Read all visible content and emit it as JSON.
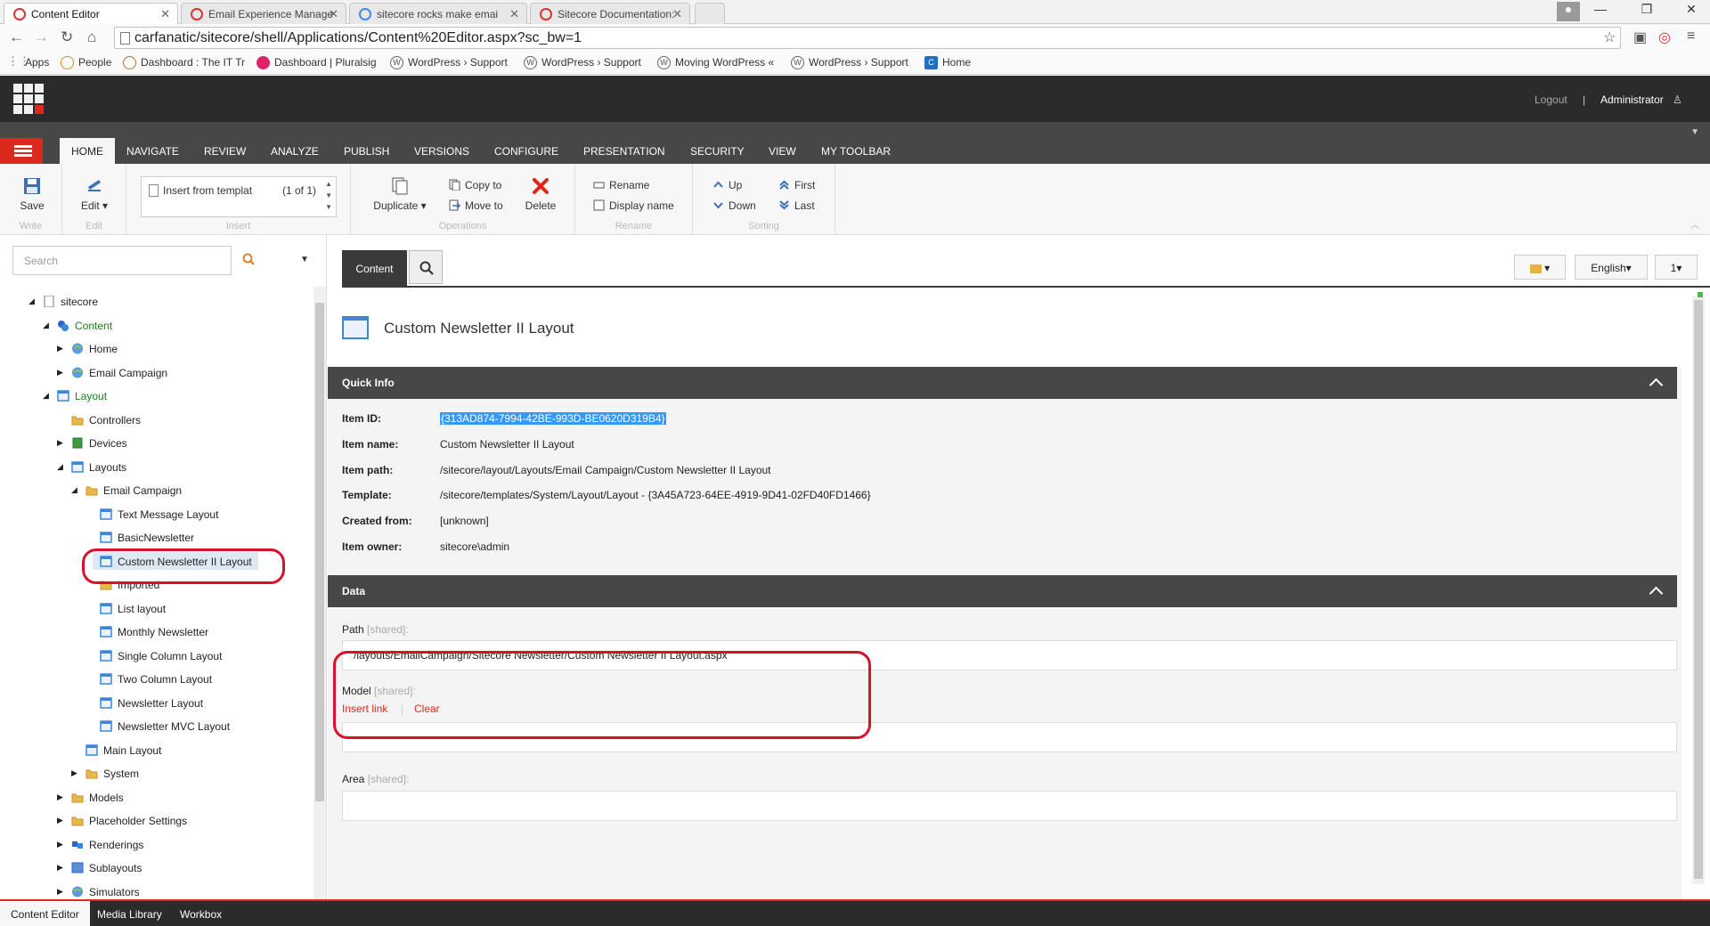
{
  "browser": {
    "tabs": [
      {
        "label": "Content Editor"
      },
      {
        "label": "Email Experience Manage"
      },
      {
        "label": "sitecore rocks make emai"
      },
      {
        "label": "Sitecore Documentation: "
      }
    ],
    "url": "carfanatic/sitecore/shell/Applications/Content%20Editor.aspx?sc_bw=1",
    "bookmarks": [
      {
        "label": "Apps"
      },
      {
        "label": "People"
      },
      {
        "label": "Dashboard : The IT Tr"
      },
      {
        "label": "Dashboard | Pluralsig"
      },
      {
        "label": "WordPress › Support"
      },
      {
        "label": "WordPress › Support"
      },
      {
        "label": "Moving WordPress «"
      },
      {
        "label": "WordPress › Support"
      },
      {
        "label": "Home"
      }
    ]
  },
  "header": {
    "logout": "Logout",
    "separator": "|",
    "user": "Administrator"
  },
  "ribbon_tabs": [
    "HOME",
    "NAVIGATE",
    "REVIEW",
    "ANALYZE",
    "PUBLISH",
    "VERSIONS",
    "CONFIGURE",
    "PRESENTATION",
    "SECURITY",
    "VIEW",
    "MY TOOLBAR"
  ],
  "ribbon": {
    "save": "Save",
    "edit": "Edit",
    "write_group": "Write",
    "edit_group": "Edit",
    "insert_from": "Insert from templat",
    "insert_count": "(1 of 1)",
    "insert_group": "Insert",
    "duplicate": "Duplicate",
    "copy_to": "Copy to",
    "move_to": "Move to",
    "delete": "Delete",
    "operations_group": "Operations",
    "rename": "Rename",
    "display_name": "Display name",
    "rename_group": "Rename",
    "up": "Up",
    "down": "Down",
    "first": "First",
    "last": "Last",
    "sorting_group": "Sorting"
  },
  "search": {
    "placeholder": "Search"
  },
  "tree": [
    {
      "label": "sitecore"
    },
    {
      "label": "Content"
    },
    {
      "label": "Home"
    },
    {
      "label": "Email Campaign"
    },
    {
      "label": "Layout"
    },
    {
      "label": "Controllers"
    },
    {
      "label": "Devices"
    },
    {
      "label": "Layouts"
    },
    {
      "label": "Email Campaign"
    },
    {
      "label": "Text Message Layout"
    },
    {
      "label": "BasicNewsletter"
    },
    {
      "label": "Custom Newsletter II Layout"
    },
    {
      "label": "Imported"
    },
    {
      "label": "List layout"
    },
    {
      "label": "Monthly Newsletter"
    },
    {
      "label": "Single Column Layout"
    },
    {
      "label": "Two Column Layout"
    },
    {
      "label": "Newsletter Layout"
    },
    {
      "label": "Newsletter MVC Layout"
    },
    {
      "label": "Main Layout"
    },
    {
      "label": "System"
    },
    {
      "label": "Models"
    },
    {
      "label": "Placeholder Settings"
    },
    {
      "label": "Renderings"
    },
    {
      "label": "Sublayouts"
    },
    {
      "label": "Simulators"
    }
  ],
  "content": {
    "tab_content": "Content",
    "language": "English",
    "version": "1",
    "item_title": "Custom Newsletter II Layout",
    "quick_info_title": "Quick Info",
    "quick_info": [
      {
        "label": "Item ID:",
        "value": "{313AD874-7994-42BE-993D-BE0620D319B4}"
      },
      {
        "label": "Item name:",
        "value": "Custom Newsletter II Layout"
      },
      {
        "label": "Item path:",
        "value": "/sitecore/layout/Layouts/Email Campaign/Custom Newsletter II Layout"
      },
      {
        "label": "Template:",
        "value": "/sitecore/templates/System/Layout/Layout - {3A45A723-64EE-4919-9D41-02FD40FD1466}"
      },
      {
        "label": "Created from:",
        "value": "[unknown]"
      },
      {
        "label": "Item owner:",
        "value": "sitecore\\admin"
      }
    ],
    "data_title": "Data",
    "path_label": "Path",
    "model_label": "Model",
    "area_label": "Area",
    "shared": "[shared]:",
    "path_value": "/layouts/EmailCampaign/Sitecore Newsletter/Custom Newsletter II Layout.aspx",
    "insert_link": "Insert link",
    "clear": "Clear"
  },
  "bottom_tabs": [
    "Content Editor",
    "Media Library",
    "Workbox"
  ],
  "colors": {
    "accent": "#dc291e",
    "dark": "#2b2b2b",
    "annotation": "#d8122a",
    "selection": "#3399ff"
  }
}
